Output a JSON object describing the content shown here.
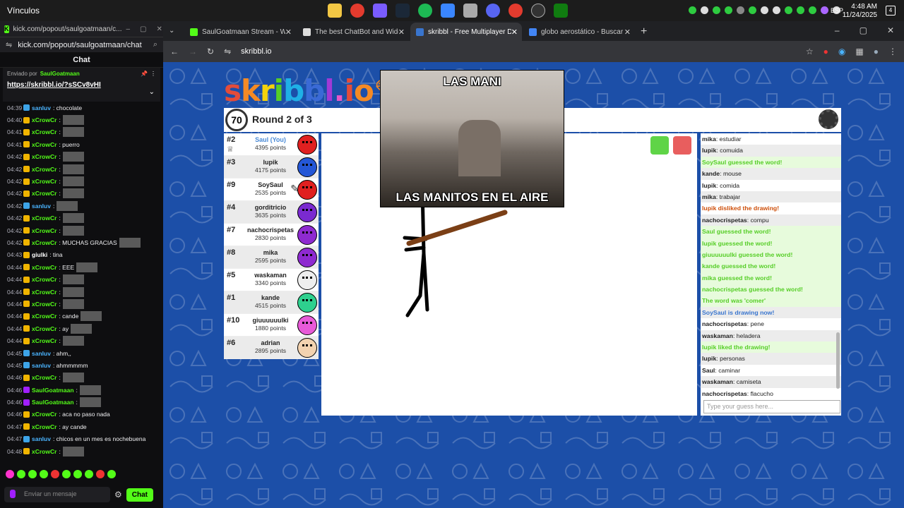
{
  "taskbar": {
    "vinculos": "Vínculos",
    "lang": "ESP",
    "time": "4:48 AM",
    "date": "11/24/2025",
    "notif_count": "4"
  },
  "popout": {
    "tab_title": "kick.com/popout/saulgoatmaan/c...",
    "url": "kick.com/popout/saulgoatmaan/chat",
    "title": "Chat",
    "pinned_by": "Enviado por",
    "pinned_user": "SaulGoatmaan",
    "pinned_link": "https://skribbl.io/?sSCv8vHI",
    "messages": [
      {
        "t": "04:39",
        "u": "sanluv",
        "uc": "#4ab4ff",
        "m": ": chocolate",
        "b": "#3da4e8"
      },
      {
        "t": "04:40",
        "u": "xCrowCr",
        "uc": "#53fc18",
        "m": ":",
        "b": "#f0b400"
      },
      {
        "t": "04:41",
        "u": "xCrowCr",
        "uc": "#53fc18",
        "m": ":",
        "b": "#f0b400"
      },
      {
        "t": "04:41",
        "u": "xCrowCr",
        "uc": "#53fc18",
        "m": ": puerro",
        "b": "#f0b400"
      },
      {
        "t": "04:42",
        "u": "xCrowCr",
        "uc": "#53fc18",
        "m": ":",
        "b": "#f0b400"
      },
      {
        "t": "04:42",
        "u": "xCrowCr",
        "uc": "#53fc18",
        "m": ":",
        "b": "#f0b400"
      },
      {
        "t": "04:42",
        "u": "xCrowCr",
        "uc": "#53fc18",
        "m": ":",
        "b": "#f0b400"
      },
      {
        "t": "04:42",
        "u": "xCrowCr",
        "uc": "#53fc18",
        "m": ":",
        "b": "#f0b400"
      },
      {
        "t": "04:42",
        "u": "sanluv",
        "uc": "#4ab4ff",
        "m": ":",
        "b": "#3da4e8"
      },
      {
        "t": "04:42",
        "u": "xCrowCr",
        "uc": "#53fc18",
        "m": ":",
        "b": "#f0b400"
      },
      {
        "t": "04:42",
        "u": "xCrowCr",
        "uc": "#53fc18",
        "m": ":",
        "b": "#f0b400"
      },
      {
        "t": "04:42",
        "u": "xCrowCr",
        "uc": "#53fc18",
        "m": ": MUCHAS GRACIAS",
        "b": "#f0b400"
      },
      {
        "t": "04:43",
        "u": "giulki",
        "uc": "#ffffff",
        "m": ": tina",
        "b": "#f0b400"
      },
      {
        "t": "04:44",
        "u": "xCrowCr",
        "uc": "#53fc18",
        "m": ": EEE",
        "b": "#f0b400"
      },
      {
        "t": "04:44",
        "u": "xCrowCr",
        "uc": "#53fc18",
        "m": ":",
        "b": "#f0b400"
      },
      {
        "t": "04:44",
        "u": "xCrowCr",
        "uc": "#53fc18",
        "m": ":",
        "b": "#f0b400"
      },
      {
        "t": "04:44",
        "u": "xCrowCr",
        "uc": "#53fc18",
        "m": ":",
        "b": "#f0b400"
      },
      {
        "t": "04:44",
        "u": "xCrowCr",
        "uc": "#53fc18",
        "m": ": cande",
        "b": "#f0b400"
      },
      {
        "t": "04:44",
        "u": "xCrowCr",
        "uc": "#53fc18",
        "m": ": ay",
        "b": "#f0b400"
      },
      {
        "t": "04:44",
        "u": "xCrowCr",
        "uc": "#53fc18",
        "m": ":",
        "b": "#f0b400"
      },
      {
        "t": "04:45",
        "u": "sanluv",
        "uc": "#4ab4ff",
        "m": ": ahm,,",
        "b": "#3da4e8"
      },
      {
        "t": "04:45",
        "u": "sanluv",
        "uc": "#4ab4ff",
        "m": ": ahmmmmm",
        "b": "#3da4e8"
      },
      {
        "t": "04:46",
        "u": "xCrowCr",
        "uc": "#53fc18",
        "m": ":",
        "b": "#f0b400"
      },
      {
        "t": "04:46",
        "u": "SaulGoatmaan",
        "uc": "#53fc18",
        "m": ":",
        "b": "#a01fff"
      },
      {
        "t": "04:46",
        "u": "SaulGoatmaan",
        "uc": "#53fc18",
        "m": ":",
        "b": "#a01fff"
      },
      {
        "t": "04:46",
        "u": "xCrowCr",
        "uc": "#53fc18",
        "m": ": aca no paso nada",
        "b": "#f0b400"
      },
      {
        "t": "04:47",
        "u": "xCrowCr",
        "uc": "#53fc18",
        "m": ": ay cande",
        "b": "#f0b400"
      },
      {
        "t": "04:47",
        "u": "sanluv",
        "uc": "#4ab4ff",
        "m": ": chicos en un mes es nochebuena",
        "b": "#3da4e8"
      },
      {
        "t": "04:48",
        "u": "xCrowCr",
        "uc": "#53fc18",
        "m": ":",
        "b": "#f0b400"
      }
    ],
    "input_placeholder": "Enviar un mensaje",
    "chat_button": "Chat"
  },
  "browser": {
    "tabs": [
      {
        "label": "SaulGoatmaan Stream - W",
        "color": "#53fc18"
      },
      {
        "label": "The best ChatBot and Widgets",
        "color": "#ddd"
      },
      {
        "label": "skribbl - Free Multiplayer Draw",
        "color": "#3975ce"
      },
      {
        "label": "globo aerostático - Buscar con",
        "color": "#4285f4"
      }
    ],
    "url": "skribbl.io"
  },
  "game": {
    "logo": "skribbl.io",
    "timer": "70",
    "round": "Round 2 of 3",
    "players": [
      {
        "rank": "#2",
        "name": "Saul (You)",
        "pts": "4395 points",
        "color": "#e02020",
        "you": true
      },
      {
        "rank": "#3",
        "name": "lupik",
        "pts": "4175 points",
        "color": "#2457d6"
      },
      {
        "rank": "#9",
        "name": "SoySaul",
        "pts": "2535 points",
        "color": "#e02020"
      },
      {
        "rank": "#4",
        "name": "gorditricio",
        "pts": "3635 points",
        "color": "#7a2ad0"
      },
      {
        "rank": "#7",
        "name": "nachocrispetas",
        "pts": "2830 points",
        "color": "#8e2ad0"
      },
      {
        "rank": "#8",
        "name": "mika",
        "pts": "2595 points",
        "color": "#8e2ad0"
      },
      {
        "rank": "#5",
        "name": "waskaman",
        "pts": "3340 points",
        "color": "#eeeeee"
      },
      {
        "rank": "#1",
        "name": "kande",
        "pts": "4515 points",
        "color": "#2ed08e"
      },
      {
        "rank": "#10",
        "name": "giuuuuuulki",
        "pts": "1880 points",
        "color": "#e85ad8"
      },
      {
        "rank": "#6",
        "name": "adrian",
        "pts": "2895 points",
        "color": "#f3d3b0"
      }
    ],
    "chat": [
      {
        "u": "mika",
        "m": "estudiar",
        "type": "normal"
      },
      {
        "u": "lupik",
        "m": "comuida",
        "type": "normal"
      },
      {
        "u": "",
        "m": "SoySaul guessed the word!",
        "type": "green"
      },
      {
        "u": "kande",
        "m": "mouse",
        "type": "normal"
      },
      {
        "u": "lupik",
        "m": "comida",
        "type": "normal"
      },
      {
        "u": "mika",
        "m": "trabajar",
        "type": "normal"
      },
      {
        "u": "",
        "m": "lupik disliked the drawing!",
        "type": "orange"
      },
      {
        "u": "nachocrispetas",
        "m": "compu",
        "type": "normal"
      },
      {
        "u": "",
        "m": "Saul guessed the word!",
        "type": "green"
      },
      {
        "u": "",
        "m": "lupik guessed the word!",
        "type": "green"
      },
      {
        "u": "",
        "m": "giuuuuuulki guessed the word!",
        "type": "green"
      },
      {
        "u": "",
        "m": "kande guessed the word!",
        "type": "green"
      },
      {
        "u": "",
        "m": "mika guessed the word!",
        "type": "green"
      },
      {
        "u": "",
        "m": "nachocrispetas guessed the word!",
        "type": "green"
      },
      {
        "u": "",
        "m": "The word was 'comer'",
        "type": "green"
      },
      {
        "u": "",
        "m": "SoySaul is drawing now!",
        "type": "blue"
      },
      {
        "u": "nachocrispetas",
        "m": "pene",
        "type": "normal"
      },
      {
        "u": "waskaman",
        "m": "heladera",
        "type": "normal"
      },
      {
        "u": "",
        "m": "lupik liked the drawing!",
        "type": "green"
      },
      {
        "u": "lupik",
        "m": "personas",
        "type": "normal"
      },
      {
        "u": "Saul",
        "m": "caminar",
        "type": "normal"
      },
      {
        "u": "waskaman",
        "m": "camiseta",
        "type": "normal"
      },
      {
        "u": "nachocrispetas",
        "m": "flacucho",
        "type": "normal"
      }
    ],
    "guess_placeholder": "Type your guess here...",
    "meme_top": "LAS MANI",
    "meme_bottom": "LAS MANITOS EN EL AIRE"
  }
}
